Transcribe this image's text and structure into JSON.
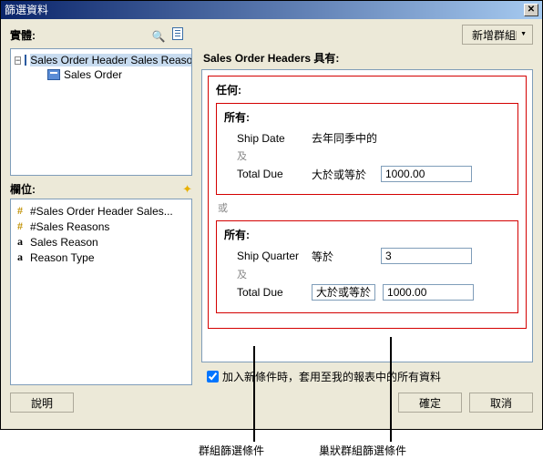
{
  "titlebar": {
    "title": "篩選資料"
  },
  "toolbar": {
    "entity_label": "實體:",
    "new_group_label": "新增群組"
  },
  "tree": {
    "root": "Sales Order Header Sales Reason",
    "child": "Sales Order"
  },
  "fields_section": {
    "label": "欄位:",
    "items": [
      {
        "icon": "hash",
        "label": "#Sales Order Header Sales..."
      },
      {
        "icon": "hash",
        "label": "#Sales Reasons"
      },
      {
        "icon": "a",
        "label": "Sales Reason"
      },
      {
        "icon": "a",
        "label": "Reason Type"
      }
    ]
  },
  "right": {
    "header": "Sales Order Headers 具有:",
    "any_label": "任何:",
    "all_label": "所有:",
    "or_label": "或",
    "and_label": "及",
    "group1": {
      "c1": {
        "field": "Ship Date",
        "op": "去年同季中的"
      },
      "c2": {
        "field": "Total Due",
        "op": "大於或等於",
        "value": "1000.00"
      }
    },
    "group2": {
      "c1": {
        "field": "Ship Quarter",
        "op": "等於",
        "value": "3"
      },
      "c2": {
        "field": "Total Due",
        "op": "大於或等於",
        "value": "1000.00"
      }
    }
  },
  "checkbox": {
    "label": "加入新條件時，套用至我的報表中的所有資料"
  },
  "buttons": {
    "help": "說明",
    "ok": "確定",
    "cancel": "取消"
  },
  "annotations": {
    "a1": "群組篩選條件",
    "a2": "巢狀群組篩選條件"
  }
}
